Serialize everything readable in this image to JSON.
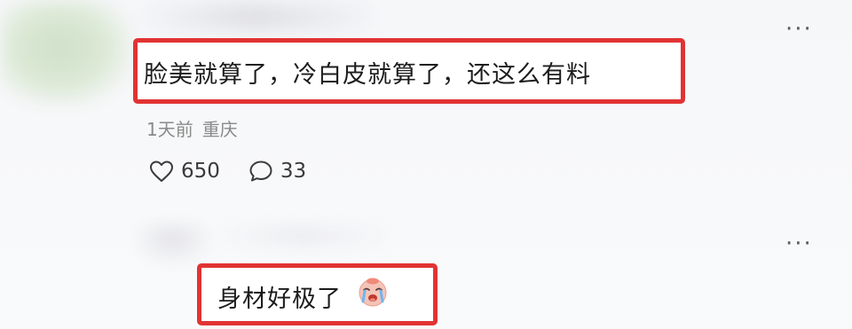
{
  "comments": [
    {
      "text": "脸美就算了，冷白皮就算了，还这么有料",
      "time": "1天前",
      "location": "重庆",
      "likes": "650",
      "replies": "33",
      "more_label": "···"
    },
    {
      "text": "身材好极了",
      "emoji": "crying-face-emoji",
      "more_label": "···"
    }
  ],
  "colors": {
    "highlight_border": "#e13333",
    "meta_text": "#8a8a8a"
  },
  "icons": {
    "like": "heart-outline-icon",
    "reply": "speech-bubble-icon",
    "more": "more-dots-icon"
  }
}
